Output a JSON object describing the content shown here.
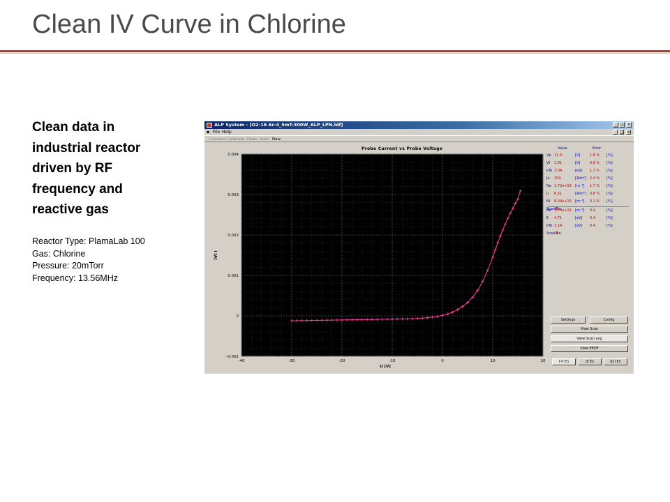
{
  "slide": {
    "title": "Clean IV Curve in Chlorine",
    "lead_lines": [
      "Clean data in",
      "industrial reactor",
      "driven by RF",
      "frequency and",
      "reactive gas"
    ],
    "specs": [
      "Reactor Type: PlamaLab 100",
      "Gas: Chlorine",
      "Pressure: 20mTorr",
      "Frequency: 13.56MHz"
    ]
  },
  "app": {
    "window_title": "ALP System - [O2-16 Ar-4_5mT-300W_ALP_LPN.ldf]",
    "menu": [
      "File",
      "Help"
    ],
    "toolbar": [
      "Connect",
      "Calibrate",
      "Clean",
      "Scan",
      "New"
    ],
    "plot_title": "Probe Current vs Probe Voltage",
    "params_header": {
      "value": "Value",
      "error": "Error"
    },
    "params": [
      {
        "name": "Vp",
        "value": "11.4",
        "unit": "[V]",
        "error": "1.8 %",
        "pct": "[%]"
      },
      {
        "name": "Vf",
        "value": "1.91",
        "unit": "[V]",
        "error": "0.8 %",
        "pct": "[%]"
      },
      {
        "name": "kTe",
        "value": "3.04",
        "unit": "[eV]",
        "error": "1.3 %",
        "pct": "[%]"
      },
      {
        "name": "Je",
        "value": "209",
        "unit": "[A/m²]",
        "error": "2.4 %",
        "pct": "[%]"
      },
      {
        "name": "Ne",
        "value": "1.72e+16",
        "unit": "[m⁻³]",
        "error": "1.7 %",
        "pct": "[%]"
      },
      {
        "name": "Ji",
        "value": "6.51",
        "unit": "[A/m²]",
        "error": "0.6 %",
        "pct": "[%]"
      },
      {
        "name": "Ni",
        "value": "8.04e+16",
        "unit": "[m⁻³]",
        "error": "0.1 %",
        "pct": "[%]"
      },
      {
        "name": "Scan No.",
        "value": "30",
        "unit": "",
        "error": "",
        "pct": ""
      }
    ],
    "params2": [
      {
        "name": "Ne",
        "value": "1.76e+16",
        "unit": "[m⁻³]",
        "error": "0.4",
        "pct": "[%]"
      },
      {
        "name": "E",
        "value": "4.71",
        "unit": "[eV]",
        "error": "0.4",
        "pct": "[%]"
      },
      {
        "name": "kTe",
        "value": "3.14",
        "unit": "[eV]",
        "error": "0.4",
        "pct": "[%]"
      },
      {
        "name": "Scan No.",
        "value": "29",
        "unit": "",
        "error": "",
        "pct": ""
      }
    ],
    "buttons": {
      "settings": "Settings",
      "config": "Config",
      "view_scan": "View Scan",
      "view_scan_avg": "View Scan avg",
      "view_eedf": "View EEDF",
      "tab_iv": "I-V En",
      "tab_d": "dI En",
      "tab_d2": "d2I En"
    },
    "colors": {
      "value_text": "#c00000",
      "header_text": "#0000c0",
      "curve": "#ff3fa0",
      "plot_bg": "#000000"
    }
  },
  "chart_data": {
    "type": "line",
    "title": "Probe Current vs Probe Voltage",
    "xlabel": "U [V]",
    "ylabel": "I [A]",
    "xlim": [
      -40,
      20
    ],
    "ylim": [
      -0.001,
      0.004
    ],
    "xticks": [
      -40,
      -30,
      -20,
      -10,
      0,
      10,
      20
    ],
    "yticks": [
      -0.001,
      0,
      0.001,
      0.002,
      0.003,
      0.004
    ],
    "xtick_labels": [
      "-40",
      "-30",
      "-20",
      "-10",
      "0",
      "10",
      "20"
    ],
    "ytick_labels": [
      "-0.001",
      "0",
      "0.001",
      "0.002",
      "0.003",
      "0.004"
    ],
    "grid": true,
    "series": [
      {
        "x": [
          -30,
          -29,
          -28,
          -27,
          -26,
          -25,
          -24,
          -23,
          -22,
          -21,
          -20,
          -19,
          -18,
          -17,
          -16,
          -15,
          -14,
          -13,
          -12,
          -11,
          -10,
          -9,
          -8,
          -7,
          -6,
          -5,
          -4,
          -3,
          -2,
          -1,
          0,
          1,
          2,
          3,
          4,
          5,
          6,
          7,
          8,
          9,
          10,
          10.5,
          11,
          11.5,
          12,
          12.5,
          13,
          13.5,
          14,
          14.5,
          15,
          15.5
        ],
        "y": [
          -0.00012,
          -0.00012,
          -0.000118,
          -0.000116,
          -0.000114,
          -0.000112,
          -0.00011,
          -0.000108,
          -0.000106,
          -0.000104,
          -0.000102,
          -0.0001,
          -9.8e-05,
          -9.6e-05,
          -9.4e-05,
          -9.2e-05,
          -9e-05,
          -8.8e-05,
          -8.6e-05,
          -8.4e-05,
          -8.2e-05,
          -8e-05,
          -7.8e-05,
          -7.5e-05,
          -7e-05,
          -6.3e-05,
          -5.5e-05,
          -4.5e-05,
          -3.2e-05,
          -1.5e-05,
          1e-05,
          4.5e-05,
          9e-05,
          0.00015,
          0.00023,
          0.00033,
          0.00046,
          0.00063,
          0.00085,
          0.00113,
          0.00145,
          0.00163,
          0.00181,
          0.00197,
          0.00212,
          0.00227,
          0.00241,
          0.00254,
          0.00266,
          0.00278,
          0.00289,
          0.00309
        ]
      }
    ]
  }
}
